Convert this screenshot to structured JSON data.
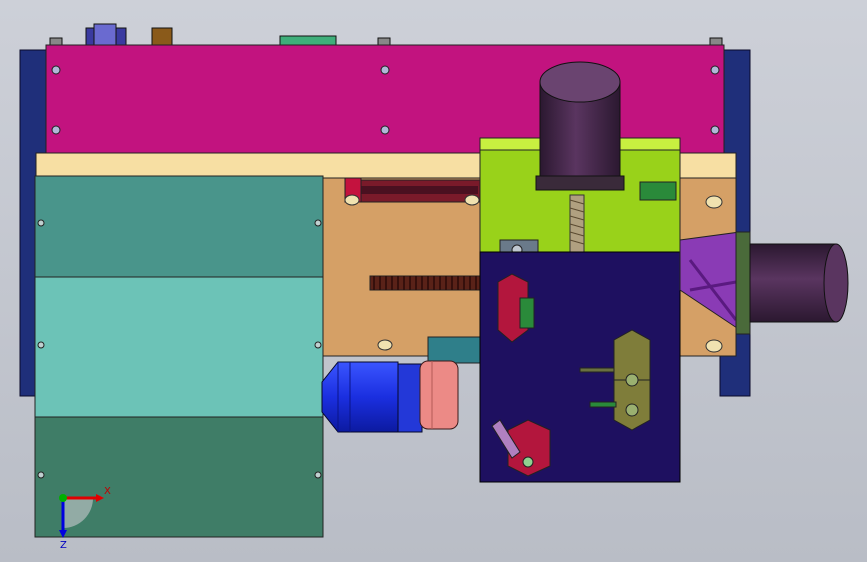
{
  "triad": {
    "x_label": "X",
    "z_label": "Z"
  },
  "colors": {
    "background": "#c6c9d1",
    "frame": "#1f2f7a",
    "magenta_plate": "#c2137f",
    "cream_strip": "#f7dfa3",
    "tan_plate": "#d5a066",
    "teal_upper": "#49958b",
    "teal_mid": "#6cc3b7",
    "teal_lower": "#3f7d67",
    "navy_block": "#1e1060",
    "lime_bracket": "#99d21a",
    "motor_body": "#4c2b4f",
    "blue_motor": "#1b2fe0",
    "salmon_coupler": "#ec8a86",
    "violet_mount": "#8a3bb5",
    "red_parts": "#b3163d",
    "olive_block": "#7f7d3a",
    "axis_x": "#e00000",
    "axis_y": "#00b000",
    "axis_z": "#0000e0"
  }
}
